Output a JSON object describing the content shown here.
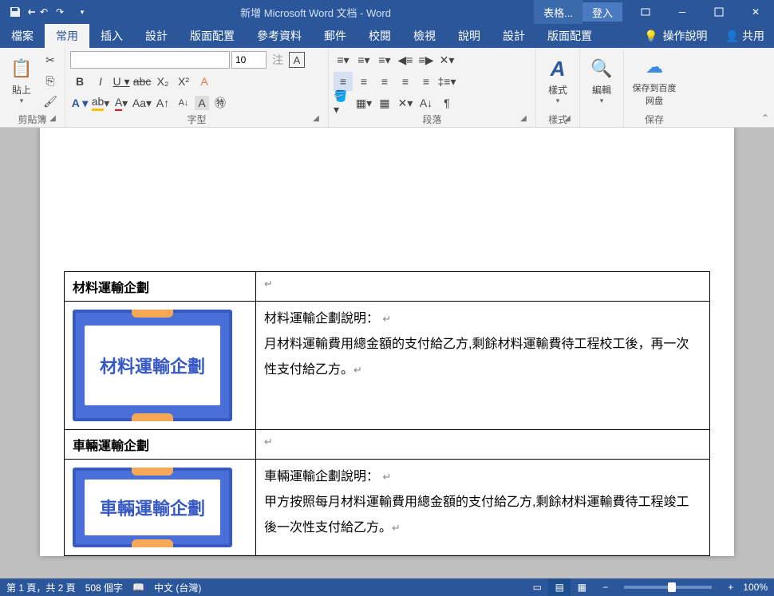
{
  "titlebar": {
    "title": "新增 Microsoft Word 文档  -  Word",
    "context": "表格...",
    "login": "登入"
  },
  "tabs": {
    "file": "檔案",
    "home": "常用",
    "insert": "插入",
    "design": "設計",
    "layout": "版面配置",
    "references": "參考資料",
    "mailings": "郵件",
    "review": "校閱",
    "view": "檢視",
    "help": "說明",
    "tdesign": "設計",
    "tlayout": "版面配置",
    "tellme": "操作說明",
    "share": "共用"
  },
  "ribbon": {
    "clipboard": {
      "label": "剪貼簿",
      "paste": "貼上"
    },
    "font": {
      "label": "字型",
      "size": "10"
    },
    "paragraph": {
      "label": "段落"
    },
    "styles": {
      "label": "樣式",
      "btn": "樣式"
    },
    "editing": {
      "label": "",
      "btn": "編輯"
    },
    "save": {
      "label": "保存",
      "btn": "保存到百度网盘"
    }
  },
  "document": {
    "row1": {
      "title": "材料運輸企劃",
      "imgtext": "材料運輸企劃",
      "desc_title": "材料運輸企劃說明：",
      "desc_body": "月材料運輸費用總金額的支付給乙方,剩餘材料運輸費待工程校工後，再一次性支付給乙方。"
    },
    "row2": {
      "title": "車輛運輸企劃",
      "imgtext": "車輛運輸企劃",
      "desc_title": "車輛運輸企劃說明：",
      "desc_body": "甲方按照每月材料運輸費用總金額的支付給乙方,剩餘材料運輸費待工程竣工後一次性支付給乙方。"
    }
  },
  "status": {
    "page": "第 1 頁，共 2 頁",
    "words": "508 個字",
    "lang": "中文 (台灣)",
    "zoom": "100%"
  }
}
